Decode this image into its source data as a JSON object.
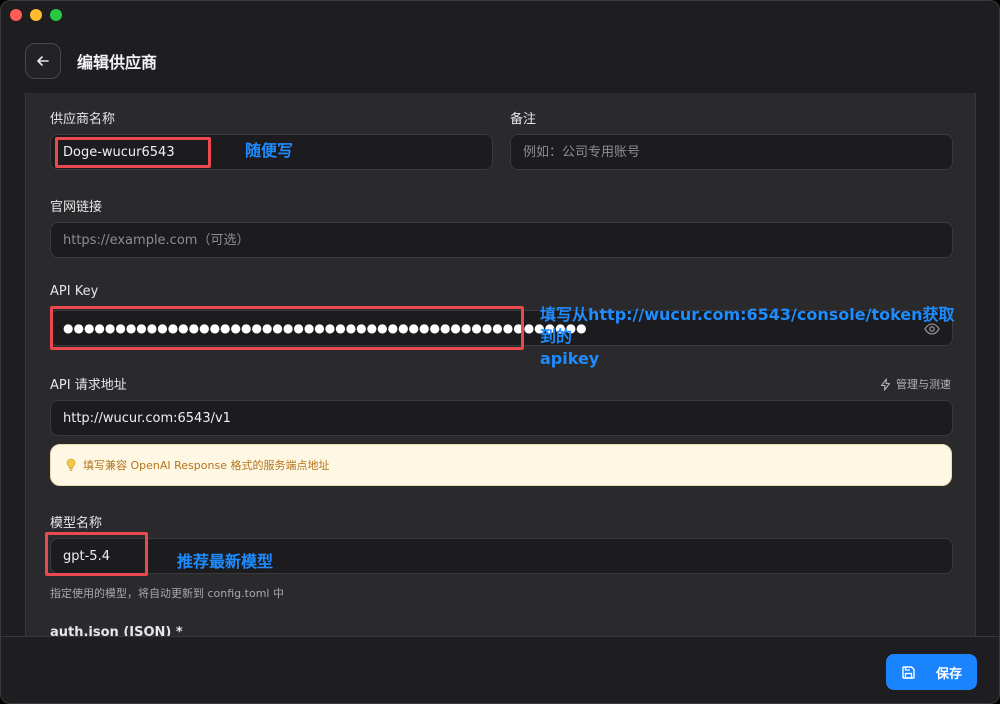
{
  "header": {
    "title": "编辑供应商"
  },
  "form": {
    "name_label": "供应商名称",
    "name_value": "Doge-wucur6543",
    "note_label": "备注",
    "note_placeholder": "例如：公司专用账号",
    "site_label": "官网链接",
    "site_placeholder": "https://example.com（可选）",
    "apikey_label": "API Key",
    "apikey_masked": "●●●●●●●●●●●●●●●●●●●●●●●●●●●●●●●●●●●●●●●●●●●●●●●●●●",
    "endpoint_label": "API 请求地址",
    "manage_label": "管理与测速",
    "endpoint_value": "http://wucur.com:6543/v1",
    "endpoint_hint": "填写兼容 OpenAI Response 格式的服务端点地址",
    "model_label": "模型名称",
    "model_value": "gpt-5.4",
    "model_helper": "指定使用的模型，将自动更新到 config.toml 中",
    "auth_label": "auth.json (JSON) *"
  },
  "annotations": {
    "name_note": "随便写",
    "apikey_note_line1": "填写从http://wucur.com:6543/console/token获取到的",
    "apikey_note_line2": "apikey",
    "model_note": "推荐最新模型"
  },
  "footer": {
    "save_label": "保存"
  },
  "colors": {
    "accent": "#1a84ff",
    "annotation_blue": "#1e8cff",
    "annotation_red": "#ea4a4f",
    "hint_bg": "#fdf7e4",
    "hint_text": "#b5741a"
  },
  "icons": [
    "back-arrow-icon",
    "eye-icon",
    "lightning-icon",
    "lightbulb-icon",
    "save-icon"
  ]
}
